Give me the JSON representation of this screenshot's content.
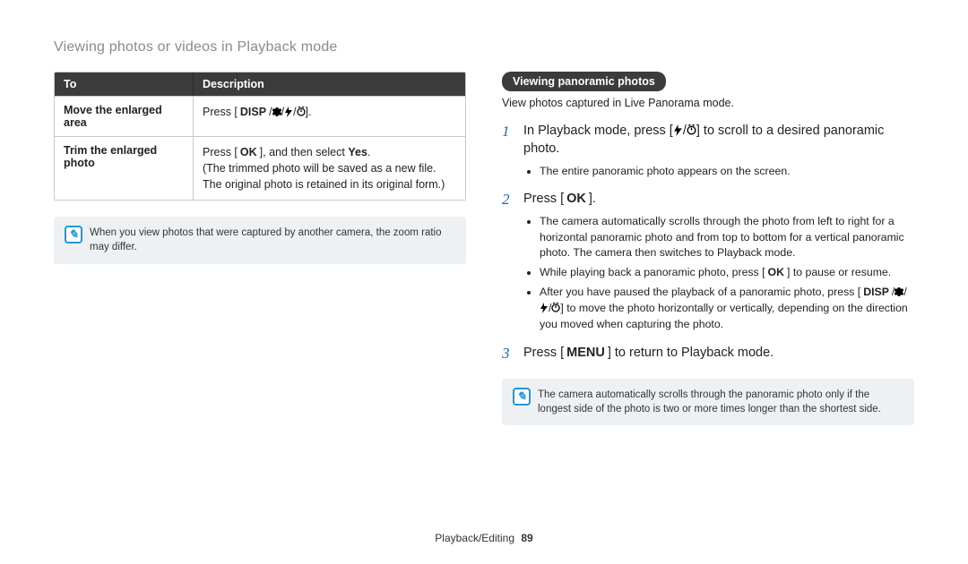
{
  "page_heading": "Viewing photos or videos in Playback mode",
  "table": {
    "head_to": "To",
    "head_desc": "Description",
    "row1_to": "Move the enlarged area",
    "row1_press": "Press [",
    "row1_press_end": "].",
    "row2_to": "Trim the enlarged photo",
    "row2_line1_a": "Press [",
    "row2_line1_b": "], and then select ",
    "row2_line1_yes": "Yes",
    "row2_line1_c": ".",
    "row2_line2": "(The trimmed photo will be saved as a new file. The original photo is retained in its original form.)"
  },
  "icons": {
    "disp": "DISP",
    "ok": "OK",
    "menu": "MENU"
  },
  "note_left": "When you view photos that were captured by another camera, the zoom ratio may differ.",
  "right": {
    "pill": "Viewing panoramic photos",
    "intro": "View photos captured in Live Panorama mode.",
    "step1_num": "1",
    "step1_a": "In Playback mode, press [",
    "step1_b": "] to scroll to a desired panoramic photo.",
    "step1_sub1": "The entire panoramic photo appears on the screen.",
    "step2_num": "2",
    "step2_a": "Press [",
    "step2_b": "].",
    "step2_sub1": "The camera automatically scrolls through the photo from left to right for a horizontal panoramic photo and from top to bottom for a vertical panoramic photo. The camera then switches to Playback mode.",
    "step2_sub2_a": "While playing back a panoramic photo, press [",
    "step2_sub2_b": "] to pause or resume.",
    "step2_sub3_a": "After you have paused the playback of a panoramic photo, press [",
    "step2_sub3_b": "] to move the photo horizontally or vertically, depending on the direction you moved when capturing the photo.",
    "step3_num": "3",
    "step3_a": "Press [",
    "step3_b": "] to return to Playback mode.",
    "note": "The camera automatically scrolls through the panoramic photo only if the longest side of the photo is two or more times longer than the shortest side."
  },
  "footer": {
    "section": "Playback/Editing",
    "page": "89"
  }
}
